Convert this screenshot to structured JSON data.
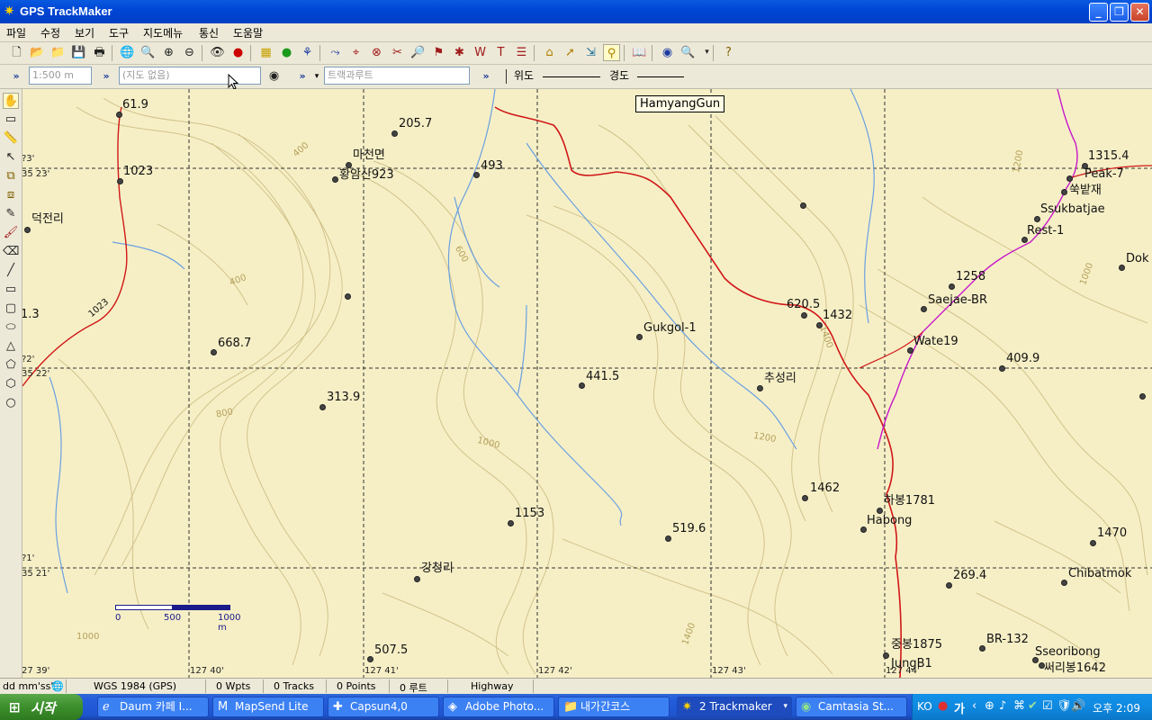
{
  "window": {
    "title": "GPS TrackMaker",
    "min": "_",
    "max": "❐",
    "close": "✕"
  },
  "menu": [
    "파일",
    "수정",
    "보기",
    "도구",
    "지도메뉴",
    "통신",
    "도움말"
  ],
  "toolbar2": {
    "scale_field": "1:500 m",
    "map_field": "(지도 없음)",
    "track_field": "트랙과루트",
    "lat_label": "위도",
    "lon_label": "경도"
  },
  "map": {
    "area_label": "HamyangGun",
    "labels": [
      {
        "id": "p-61-9",
        "text": "61.9"
      },
      {
        "id": "p-1023",
        "text": "1023"
      },
      {
        "id": "p-deokjeonri",
        "text": "덕전리"
      },
      {
        "id": "p-1-3",
        "text": "1.3"
      },
      {
        "id": "p-205-7",
        "text": "205.7"
      },
      {
        "id": "p-machon",
        "text": "마천면"
      },
      {
        "id": "p-hwanam",
        "text": "황암산923"
      },
      {
        "id": "p-493",
        "text": "493"
      },
      {
        "id": "p-668-7",
        "text": "668.7"
      },
      {
        "id": "p-313-9",
        "text": "313.9"
      },
      {
        "id": "p-441-5",
        "text": "441.5"
      },
      {
        "id": "p-gukgol",
        "text": "Gukgol-1"
      },
      {
        "id": "p-620-5",
        "text": "620.5"
      },
      {
        "id": "p-1432",
        "text": "1432"
      },
      {
        "id": "p-chuseongri",
        "text": "추성리"
      },
      {
        "id": "p-1315-4",
        "text": "1315.4"
      },
      {
        "id": "p-peak7",
        "text": "Peak-7"
      },
      {
        "id": "p-ssukbatjae-ko",
        "text": "쑥밭재"
      },
      {
        "id": "p-ssukbatjae",
        "text": "Ssukbatjae"
      },
      {
        "id": "p-rest1",
        "text": "Rest-1"
      },
      {
        "id": "p-1258",
        "text": "1258"
      },
      {
        "id": "p-saejae",
        "text": "Saejae-BR"
      },
      {
        "id": "p-water19",
        "text": "Wate19"
      },
      {
        "id": "p-409-9",
        "text": "409.9"
      },
      {
        "id": "p-dok",
        "text": "Dok"
      },
      {
        "id": "p-1462",
        "text": "1462"
      },
      {
        "id": "p-habong-ko",
        "text": "하봉1781"
      },
      {
        "id": "p-habong",
        "text": "Habong"
      },
      {
        "id": "p-1470",
        "text": "1470"
      },
      {
        "id": "p-1153",
        "text": "1153"
      },
      {
        "id": "p-519-6",
        "text": "519.6"
      },
      {
        "id": "p-gangcheongri",
        "text": "강청리"
      },
      {
        "id": "p-269-4",
        "text": "269.4"
      },
      {
        "id": "p-chibatmok",
        "text": "Chibatmok"
      },
      {
        "id": "p-507-5",
        "text": "507.5"
      },
      {
        "id": "p-jungbong-ko",
        "text": "중봉1875"
      },
      {
        "id": "p-jungb1",
        "text": "JungB1"
      },
      {
        "id": "p-br132",
        "text": "BR-132"
      },
      {
        "id": "p-sseoribong",
        "text": "Sseoribong"
      },
      {
        "id": "p-sseoribong-ko",
        "text": "써리봉1642"
      }
    ],
    "coords": {
      "lat_3523_a": "?3'",
      "lat_3523": "35 23'",
      "lat_3522_a": "?2'",
      "lat_3522": "35 22'",
      "lat_3521_a": "?1'",
      "lat_3521": "35 21'",
      "lon_12739": "27 39'",
      "lon_12740": "127 40'",
      "lon_12741": "127 41'",
      "lon_12742": "127 42'",
      "lon_12743": "127 43'",
      "lon_12744": "127 44'"
    },
    "contours": [
      "400",
      "600",
      "400",
      "800",
      "1000",
      "1200",
      "1400",
      "1200",
      "1000",
      "1000",
      "1400",
      "1023"
    ],
    "scale": {
      "zero": "0",
      "mid": "500",
      "end": "1000 m"
    }
  },
  "status": {
    "units": "dd mm'ss\"",
    "datum": "WGS 1984 (GPS)",
    "wpts": "0 Wpts",
    "tracks": "0 Tracks",
    "points": "0 Points",
    "routes": "0 루트",
    "road": "Highway"
  },
  "taskbar": {
    "start": "시작",
    "tasks": [
      {
        "label": "Daum 카페 I...",
        "icon": "ie-icon"
      },
      {
        "label": "MapSend Lite",
        "icon": "mapsend-icon"
      },
      {
        "label": "Capsun4,0",
        "icon": "capsun-icon"
      },
      {
        "label": "Adobe Photo...",
        "icon": "photoshop-icon"
      },
      {
        "label": "내가간코스",
        "icon": "folder-icon"
      },
      {
        "label": "2 Trackmaker",
        "icon": "trackmaker-icon"
      },
      {
        "label": "Camtasia St...",
        "icon": "camtasia-icon"
      }
    ],
    "lang": "KO",
    "ime": "가",
    "clock": "오후 2:09"
  }
}
